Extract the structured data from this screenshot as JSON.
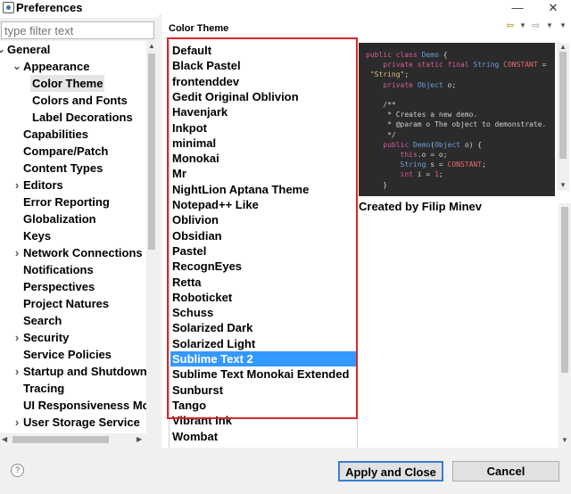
{
  "window": {
    "title": "Preferences",
    "minimize_glyph": "—",
    "maximize_glyph": "☐",
    "close_glyph": "✕"
  },
  "filter": {
    "placeholder": "type filter text",
    "value": ""
  },
  "tree": [
    {
      "label": "General",
      "expanded": true
    },
    {
      "label": "Appearance",
      "expanded": true
    },
    {
      "label": "Color Theme",
      "selected": true
    },
    {
      "label": "Colors and Fonts"
    },
    {
      "label": "Label Decorations"
    },
    {
      "label": "Capabilities"
    },
    {
      "label": "Compare/Patch"
    },
    {
      "label": "Content Types"
    },
    {
      "label": "Editors",
      "expandable": true
    },
    {
      "label": "Error Reporting"
    },
    {
      "label": "Globalization"
    },
    {
      "label": "Keys"
    },
    {
      "label": "Network Connections",
      "expandable": true
    },
    {
      "label": "Notifications"
    },
    {
      "label": "Perspectives"
    },
    {
      "label": "Project Natures"
    },
    {
      "label": "Search"
    },
    {
      "label": "Security",
      "expandable": true
    },
    {
      "label": "Service Policies"
    },
    {
      "label": "Startup and Shutdown",
      "expandable": true
    },
    {
      "label": "Tracing"
    },
    {
      "label": "UI Responsiveness Mon"
    },
    {
      "label": "User Storage Service",
      "expandable": true
    }
  ],
  "page": {
    "title": "Color Theme",
    "themes": [
      "Default",
      "Black Pastel",
      "frontenddev",
      "Gedit Original Oblivion",
      "Havenjark",
      "Inkpot",
      "minimal",
      "Monokai",
      "Mr",
      "NightLion Aptana Theme",
      "Notepad++ Like",
      "Oblivion",
      "Obsidian",
      "Pastel",
      "RecognEyes",
      "Retta",
      "Roboticket",
      "Schuss",
      "Solarized Dark",
      "Solarized Light",
      "Sublime Text 2",
      "Sublime Text Monokai Extended",
      "Sunburst",
      "Tango",
      "Vibrant Ink",
      "Wombat"
    ],
    "selected_theme": "Sublime Text 2",
    "author": "Created by Filip Minev"
  },
  "buttons": {
    "apply_close": "Apply and Close",
    "cancel": "Cancel",
    "help": "?"
  },
  "colors": {
    "selection": "#3399ff",
    "highlight_box": "#d72828",
    "preview_background": "#2b2b2b"
  },
  "icons": [
    "back-arrow-icon",
    "forward-arrow-icon",
    "help-icon"
  ]
}
